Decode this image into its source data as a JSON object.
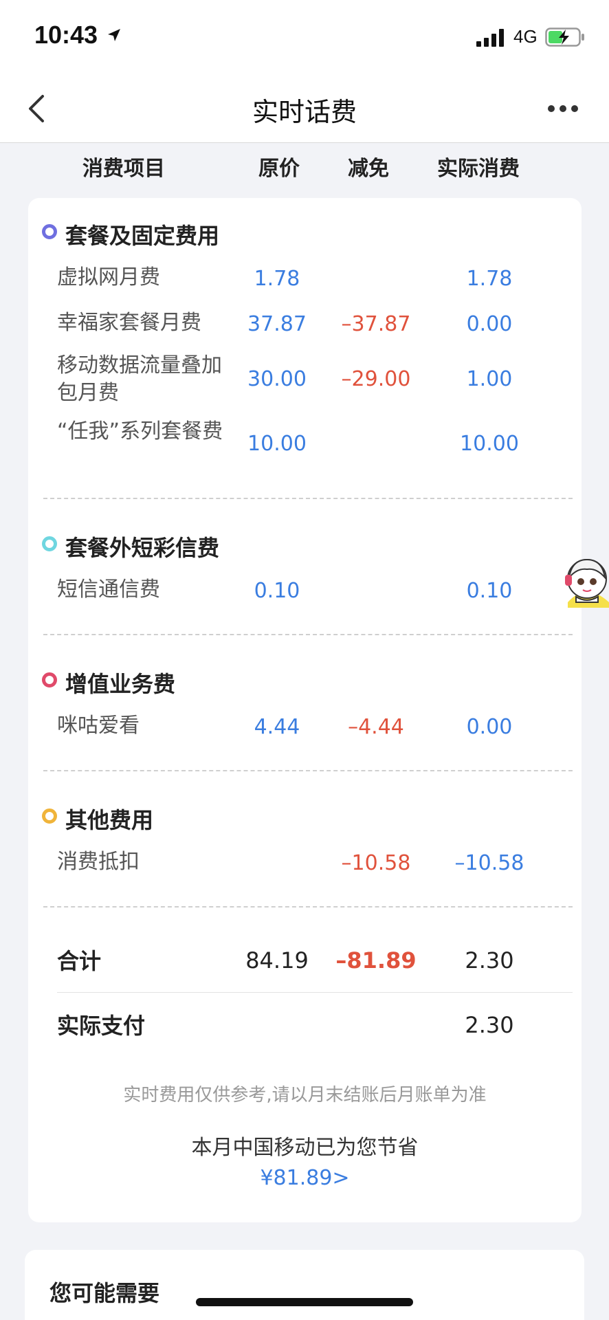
{
  "status_bar": {
    "time": "10:43",
    "network": "4G"
  },
  "nav": {
    "title": "实时话费"
  },
  "columns": {
    "item": "消费项目",
    "original": "原价",
    "discount": "减免",
    "actual": "实际消费"
  },
  "sections": [
    {
      "title": "套餐及固定费用",
      "color": "#6f6fe0",
      "rows": [
        {
          "name": "虚拟网月费",
          "original": "1.78",
          "discount": "",
          "actual": "1.78"
        },
        {
          "name": "幸福家套餐月费",
          "original": "37.87",
          "discount": "–37.87",
          "actual": "0.00"
        },
        {
          "name": "移动数据流量叠加包月费",
          "original": "30.00",
          "discount": "–29.00",
          "actual": "1.00"
        },
        {
          "name": "“任我”系列套餐费",
          "original": "10.00",
          "discount": "",
          "actual": "10.00"
        }
      ]
    },
    {
      "title": "套餐外短彩信费",
      "color": "#6fd6e0",
      "rows": [
        {
          "name": "短信通信费",
          "original": "0.10",
          "discount": "",
          "actual": "0.10"
        }
      ]
    },
    {
      "title": "增值业务费",
      "color": "#e04a6a",
      "rows": [
        {
          "name": "咪咕爱看",
          "original": "4.44",
          "discount": "–4.44",
          "actual": "0.00"
        }
      ]
    },
    {
      "title": "其他费用",
      "color": "#f0b43a",
      "rows": [
        {
          "name": "消费抵扣",
          "original": "",
          "discount": "–10.58",
          "actual": "–10.58"
        }
      ]
    }
  ],
  "totals": {
    "total_label": "合计",
    "total_original": "84.19",
    "total_discount": "–81.89",
    "total_actual": "2.30",
    "paid_label": "实际支付",
    "paid_value": "2.30"
  },
  "note": "实时费用仅供参考,请以月末结账后月账单为准",
  "savings": {
    "text": "本月中国移动已为您节省",
    "amount": "¥81.89>"
  },
  "recommend": {
    "title": "您可能需要"
  }
}
